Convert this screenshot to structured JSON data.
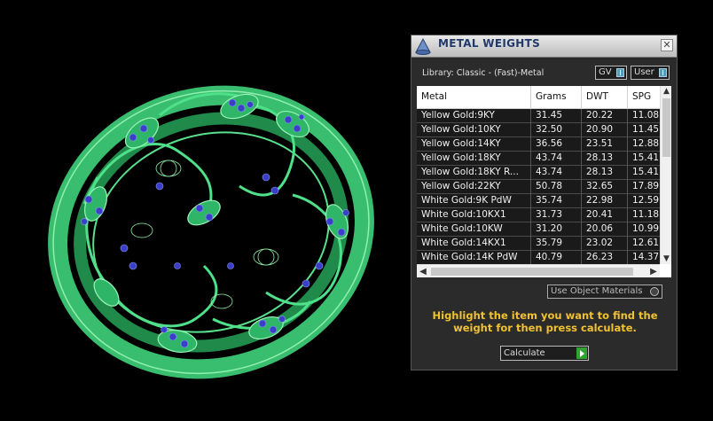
{
  "panel": {
    "title": "METAL WEIGHTS",
    "close_glyph": "✕",
    "library_label": "Library: Classic - (Fast)-Metal",
    "gv_label": "GV",
    "user_label": "User",
    "use_object_materials": "Use Object Materials",
    "instructions": "Highlight the item you want to find the weight for then press calculate.",
    "calculate_label": "Calculate",
    "icons": {
      "title": "cone-tool-icon",
      "close": "close-icon",
      "go": "play-icon"
    },
    "accent_color": "#f2c12e"
  },
  "table": {
    "headers": [
      "Metal",
      "Grams",
      "DWT",
      "SPG"
    ],
    "rows": [
      [
        "Yellow Gold:9KY",
        "31.45",
        "20.22",
        "11.08"
      ],
      [
        "Yellow Gold:10KY",
        "32.50",
        "20.90",
        "11.45"
      ],
      [
        "Yellow Gold:14KY",
        "36.56",
        "23.51",
        "12.88"
      ],
      [
        "Yellow Gold:18KY",
        "43.74",
        "28.13",
        "15.41"
      ],
      [
        "Yellow Gold:18KY R...",
        "43.74",
        "28.13",
        "15.41"
      ],
      [
        "Yellow Gold:22KY",
        "50.78",
        "32.65",
        "17.89"
      ],
      [
        "White Gold:9K PdW",
        "35.74",
        "22.98",
        "12.59"
      ],
      [
        "White Gold:10KX1",
        "31.73",
        "20.41",
        "11.18"
      ],
      [
        "White Gold:10KW",
        "31.20",
        "20.06",
        "10.99"
      ],
      [
        "White Gold:14KX1",
        "35.79",
        "23.02",
        "12.61"
      ],
      [
        "White Gold:14K PdW",
        "40.79",
        "26.23",
        "14.37"
      ]
    ]
  },
  "scrollbars": {
    "up": "▲",
    "down": "▼",
    "left": "◀",
    "right": "▶"
  }
}
